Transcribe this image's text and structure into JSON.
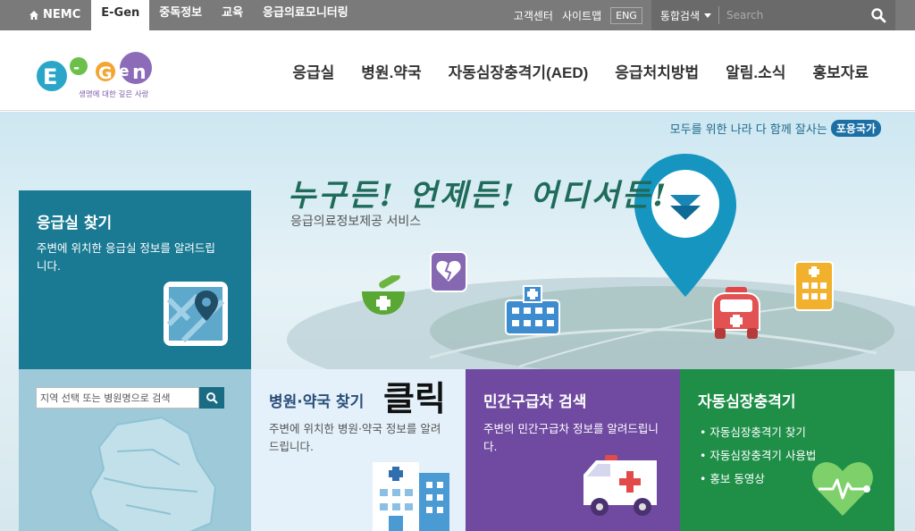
{
  "topbar": {
    "tabs": [
      {
        "label": "NEMC",
        "icon": "home-icon"
      },
      {
        "label": "E-Gen",
        "active": true
      },
      {
        "label": "중독정보"
      },
      {
        "label": "교육"
      },
      {
        "label": "응급의료모니터링"
      }
    ],
    "links": [
      "고객센터",
      "사이트맵"
    ],
    "lang": "ENG",
    "search_scope": "통합검색",
    "search_placeholder": "Search"
  },
  "header": {
    "logo_text": "E-Gen",
    "logo_tagline": "생명에 대한 깊은 사랑",
    "nav": [
      "응급실",
      "병원.약국",
      "자동심장충격기(AED)",
      "응급처치방법",
      "알림.소식",
      "홍보자료"
    ]
  },
  "hero": {
    "slogan": "모두를 위한 나라 다 함께 잘사는",
    "slogan_badge": "포용국가",
    "headline": "누구든! 언제든! 어디서든!",
    "subhead": "응급의료정보제공 서비스"
  },
  "panels": {
    "er": {
      "title": "응급실 찾기",
      "desc": "주변에 위치한 응급실 정보를 알려드립니다."
    },
    "region_search": {
      "placeholder": "지역 선택 또는 병원명으로 검색"
    },
    "hospital": {
      "title": "병원·약국 찾기",
      "click_label": "클릭",
      "desc": "주변에 위치한 병원·약국 정보를 알려드립니다."
    },
    "ambulance": {
      "title": "민간구급차 검색",
      "desc": "주변의 민간구급차 정보를 알려드립니다."
    },
    "aed": {
      "title": "자동심장충격기",
      "items": [
        "자동심장충격기 찾기",
        "자동심장충격기 사용법",
        "홍보 동영상"
      ]
    }
  },
  "colors": {
    "topbar": "#7a7a7a",
    "er_panel": "#1a7a93",
    "hospital_panel": "#e4f1fa",
    "ambulance_panel": "#6f4aa0",
    "aed_panel": "#1f8f48"
  }
}
